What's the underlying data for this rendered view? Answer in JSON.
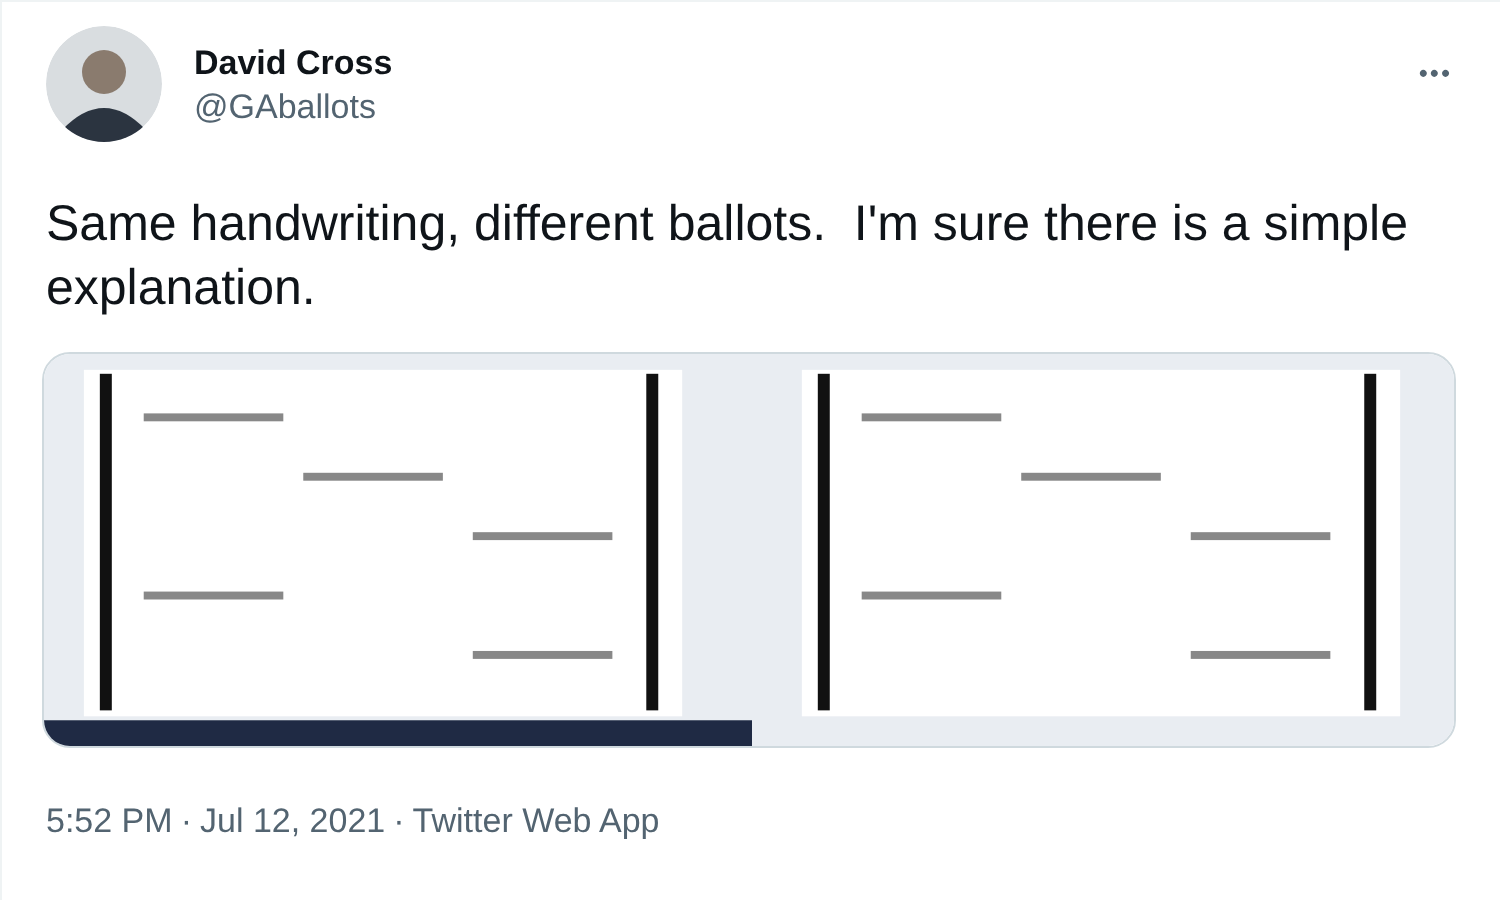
{
  "author": {
    "name": "David Cross",
    "handle": "@GAballots"
  },
  "menu": {
    "label": "•••"
  },
  "text": "Same handwriting, different ballots.  I'm sure there is a simple explanation.",
  "footer": {
    "time": "5:52 PM",
    "separator_1": "·",
    "date": "Jul 12, 2021",
    "separator_2": "·",
    "source": "Twitter Web App"
  }
}
